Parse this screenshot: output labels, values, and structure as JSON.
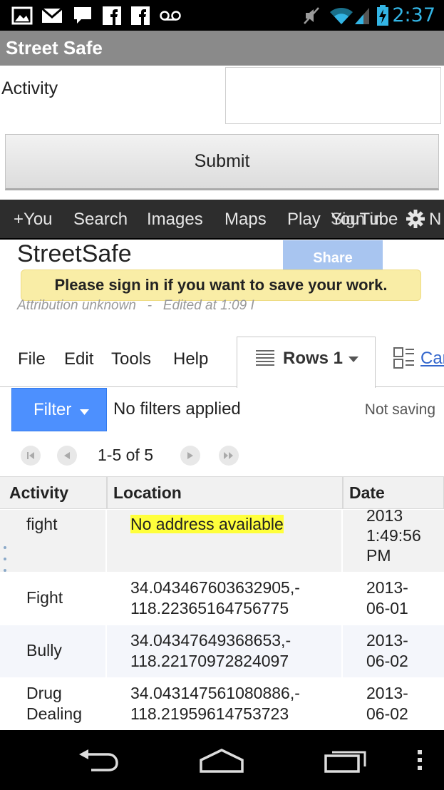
{
  "status_bar": {
    "time": "2:37",
    "accent_color": "#33b5e5",
    "left_icons": [
      "gallery-icon",
      "gmail-icon",
      "chat-icon",
      "facebook-icon",
      "facebook-icon",
      "voicemail-icon"
    ],
    "right_icons": [
      "mute-icon",
      "wifi-icon",
      "signal-icon",
      "battery-charging-icon"
    ]
  },
  "action_bar": {
    "title": "Street Safe"
  },
  "form": {
    "activity_label": "Activity",
    "activity_value": "",
    "submit_label": "Submit"
  },
  "google_bar": {
    "items": [
      "+You",
      "Search",
      "Images",
      "Maps",
      "Play",
      "YouTube",
      "Sign in"
    ],
    "overflow_char": "N"
  },
  "document": {
    "title": "StreetSafe",
    "share_label": "Share",
    "signin_banner": "Please sign in if you want to save your work.",
    "attribution": "Attribution unknown",
    "separator": "-",
    "edited": "Edited at 1:09 I"
  },
  "menu": {
    "items": [
      "File",
      "Edit",
      "Tools",
      "Help"
    ],
    "rows_tab_label": "Rows 1",
    "cards_tab_label": "Car"
  },
  "filter": {
    "button_label": "Filter",
    "status": "No filters applied",
    "saving": "Not saving"
  },
  "pager": {
    "text": "1-5 of 5"
  },
  "table": {
    "headers": [
      "Activity",
      "Location",
      "Date"
    ],
    "rows": [
      {
        "activity": "fight",
        "location": "No address available",
        "date": "2013\n1:49:56\nPM",
        "highlight_location": true
      },
      {
        "activity": "Fight",
        "location": "34.043467603632905,-\n118.22365164756775",
        "date": "2013-\n06-01"
      },
      {
        "activity": "Bully",
        "location": "34.04347649368653,-\n118.22170972824097",
        "date": "2013-\n06-02"
      },
      {
        "activity": "Drug\nDealing",
        "location": "34.043147561080886,-\n118.21959614753723",
        "date": "2013-\n06-02"
      }
    ]
  },
  "nav_bar": {
    "buttons": [
      "back-icon",
      "home-icon",
      "recent-apps-icon",
      "menu-icon"
    ]
  },
  "colors": {
    "filter_blue": "#4d90fe",
    "banner_yellow": "#f9eda6",
    "highlight_yellow": "#ffff3b",
    "share_blue": "#a8c5f0"
  }
}
